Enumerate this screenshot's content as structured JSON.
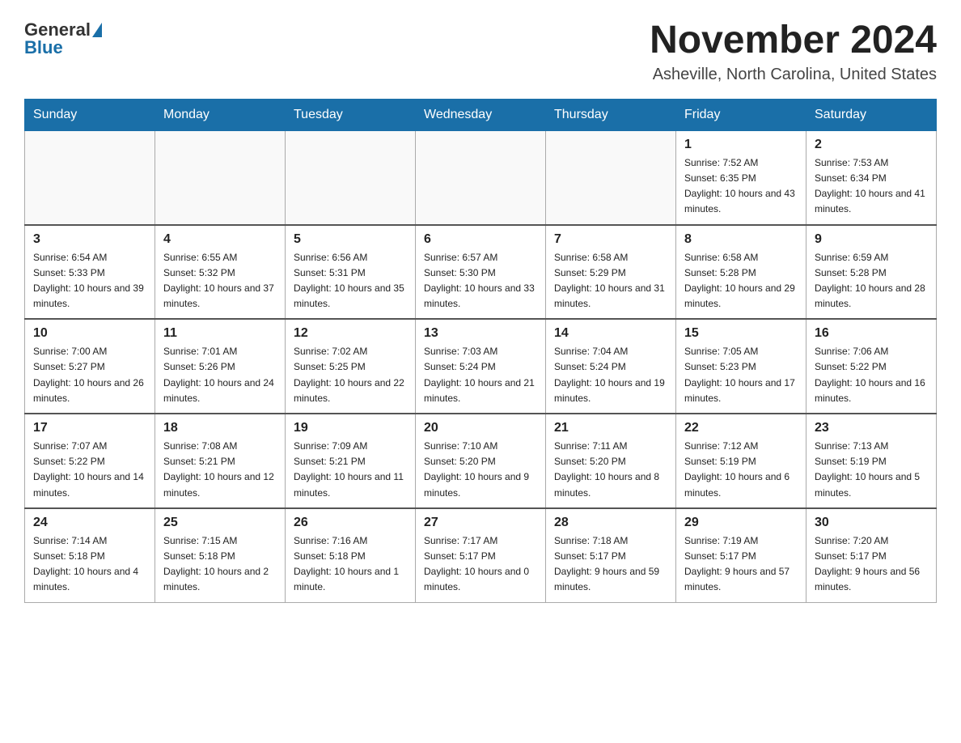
{
  "logo": {
    "general": "General",
    "blue": "Blue"
  },
  "header": {
    "month": "November 2024",
    "location": "Asheville, North Carolina, United States"
  },
  "weekdays": [
    "Sunday",
    "Monday",
    "Tuesday",
    "Wednesday",
    "Thursday",
    "Friday",
    "Saturday"
  ],
  "weeks": [
    [
      {
        "day": "",
        "info": ""
      },
      {
        "day": "",
        "info": ""
      },
      {
        "day": "",
        "info": ""
      },
      {
        "day": "",
        "info": ""
      },
      {
        "day": "",
        "info": ""
      },
      {
        "day": "1",
        "info": "Sunrise: 7:52 AM\nSunset: 6:35 PM\nDaylight: 10 hours and 43 minutes."
      },
      {
        "day": "2",
        "info": "Sunrise: 7:53 AM\nSunset: 6:34 PM\nDaylight: 10 hours and 41 minutes."
      }
    ],
    [
      {
        "day": "3",
        "info": "Sunrise: 6:54 AM\nSunset: 5:33 PM\nDaylight: 10 hours and 39 minutes."
      },
      {
        "day": "4",
        "info": "Sunrise: 6:55 AM\nSunset: 5:32 PM\nDaylight: 10 hours and 37 minutes."
      },
      {
        "day": "5",
        "info": "Sunrise: 6:56 AM\nSunset: 5:31 PM\nDaylight: 10 hours and 35 minutes."
      },
      {
        "day": "6",
        "info": "Sunrise: 6:57 AM\nSunset: 5:30 PM\nDaylight: 10 hours and 33 minutes."
      },
      {
        "day": "7",
        "info": "Sunrise: 6:58 AM\nSunset: 5:29 PM\nDaylight: 10 hours and 31 minutes."
      },
      {
        "day": "8",
        "info": "Sunrise: 6:58 AM\nSunset: 5:28 PM\nDaylight: 10 hours and 29 minutes."
      },
      {
        "day": "9",
        "info": "Sunrise: 6:59 AM\nSunset: 5:28 PM\nDaylight: 10 hours and 28 minutes."
      }
    ],
    [
      {
        "day": "10",
        "info": "Sunrise: 7:00 AM\nSunset: 5:27 PM\nDaylight: 10 hours and 26 minutes."
      },
      {
        "day": "11",
        "info": "Sunrise: 7:01 AM\nSunset: 5:26 PM\nDaylight: 10 hours and 24 minutes."
      },
      {
        "day": "12",
        "info": "Sunrise: 7:02 AM\nSunset: 5:25 PM\nDaylight: 10 hours and 22 minutes."
      },
      {
        "day": "13",
        "info": "Sunrise: 7:03 AM\nSunset: 5:24 PM\nDaylight: 10 hours and 21 minutes."
      },
      {
        "day": "14",
        "info": "Sunrise: 7:04 AM\nSunset: 5:24 PM\nDaylight: 10 hours and 19 minutes."
      },
      {
        "day": "15",
        "info": "Sunrise: 7:05 AM\nSunset: 5:23 PM\nDaylight: 10 hours and 17 minutes."
      },
      {
        "day": "16",
        "info": "Sunrise: 7:06 AM\nSunset: 5:22 PM\nDaylight: 10 hours and 16 minutes."
      }
    ],
    [
      {
        "day": "17",
        "info": "Sunrise: 7:07 AM\nSunset: 5:22 PM\nDaylight: 10 hours and 14 minutes."
      },
      {
        "day": "18",
        "info": "Sunrise: 7:08 AM\nSunset: 5:21 PM\nDaylight: 10 hours and 12 minutes."
      },
      {
        "day": "19",
        "info": "Sunrise: 7:09 AM\nSunset: 5:21 PM\nDaylight: 10 hours and 11 minutes."
      },
      {
        "day": "20",
        "info": "Sunrise: 7:10 AM\nSunset: 5:20 PM\nDaylight: 10 hours and 9 minutes."
      },
      {
        "day": "21",
        "info": "Sunrise: 7:11 AM\nSunset: 5:20 PM\nDaylight: 10 hours and 8 minutes."
      },
      {
        "day": "22",
        "info": "Sunrise: 7:12 AM\nSunset: 5:19 PM\nDaylight: 10 hours and 6 minutes."
      },
      {
        "day": "23",
        "info": "Sunrise: 7:13 AM\nSunset: 5:19 PM\nDaylight: 10 hours and 5 minutes."
      }
    ],
    [
      {
        "day": "24",
        "info": "Sunrise: 7:14 AM\nSunset: 5:18 PM\nDaylight: 10 hours and 4 minutes."
      },
      {
        "day": "25",
        "info": "Sunrise: 7:15 AM\nSunset: 5:18 PM\nDaylight: 10 hours and 2 minutes."
      },
      {
        "day": "26",
        "info": "Sunrise: 7:16 AM\nSunset: 5:18 PM\nDaylight: 10 hours and 1 minute."
      },
      {
        "day": "27",
        "info": "Sunrise: 7:17 AM\nSunset: 5:17 PM\nDaylight: 10 hours and 0 minutes."
      },
      {
        "day": "28",
        "info": "Sunrise: 7:18 AM\nSunset: 5:17 PM\nDaylight: 9 hours and 59 minutes."
      },
      {
        "day": "29",
        "info": "Sunrise: 7:19 AM\nSunset: 5:17 PM\nDaylight: 9 hours and 57 minutes."
      },
      {
        "day": "30",
        "info": "Sunrise: 7:20 AM\nSunset: 5:17 PM\nDaylight: 9 hours and 56 minutes."
      }
    ]
  ]
}
